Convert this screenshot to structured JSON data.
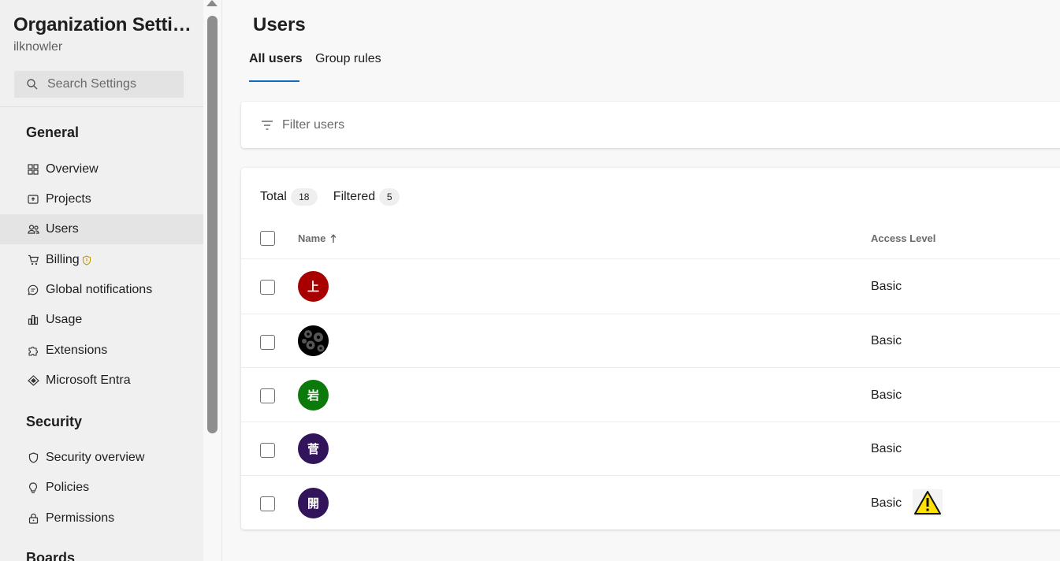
{
  "sidebar": {
    "title": "Organization Settings",
    "subtitle": "ilknowler",
    "search_placeholder": "Search Settings",
    "general_heading": "General",
    "general_items": [
      {
        "label": "Overview",
        "icon": "overview-icon"
      },
      {
        "label": "Projects",
        "icon": "projects-icon"
      },
      {
        "label": "Users",
        "icon": "users-icon",
        "selected": true
      },
      {
        "label": "Billing",
        "icon": "cart-icon"
      },
      {
        "label": "Global notifications",
        "icon": "chat-icon"
      },
      {
        "label": "Usage",
        "icon": "usage-chart-icon"
      },
      {
        "label": "Extensions",
        "icon": "puzzle-icon"
      },
      {
        "label": "Microsoft Entra",
        "icon": "entra-icon"
      }
    ],
    "security_heading": "Security",
    "security_items": [
      {
        "label": "Security overview",
        "icon": "shield-icon"
      },
      {
        "label": "Policies",
        "icon": "lightbulb-icon"
      },
      {
        "label": "Permissions",
        "icon": "lock-icon"
      }
    ],
    "boards_heading": "Boards"
  },
  "main": {
    "title": "Users",
    "tabs": [
      {
        "label": "All users",
        "active": true
      },
      {
        "label": "Group rules",
        "active": false
      }
    ],
    "filter_placeholder": "Filter users",
    "counts": {
      "total_label": "Total",
      "total_value": "18",
      "filtered_label": "Filtered",
      "filtered_value": "5"
    },
    "columns": {
      "name": "Name",
      "access": "Access Level"
    },
    "rows": [
      {
        "avatar_char": "上",
        "avatar_color": "#a80000",
        "access": "Basic",
        "warning": false
      },
      {
        "avatar_char": "",
        "avatar_color": "#000000",
        "access": "Basic",
        "warning": false,
        "avatar_pattern": "gears"
      },
      {
        "avatar_char": "岩",
        "avatar_color": "#0b7a0b",
        "access": "Basic",
        "warning": false
      },
      {
        "avatar_char": "菅",
        "avatar_color": "#32145a",
        "access": "Basic",
        "warning": false
      },
      {
        "avatar_char": "開",
        "avatar_color": "#32145a",
        "access": "Basic",
        "warning": true
      }
    ]
  },
  "colors": {
    "accent": "#0f6cbd",
    "warning_yellow": "#ffe200"
  }
}
